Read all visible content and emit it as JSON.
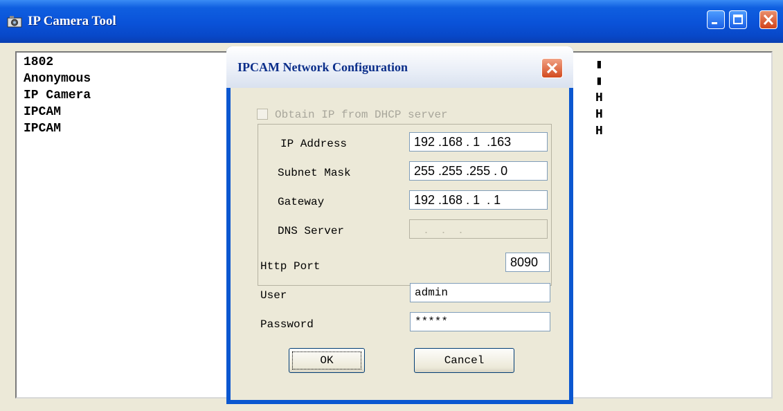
{
  "window": {
    "title": "IP Camera Tool",
    "colors": {
      "titlebar": "#0a52d8",
      "close": "#d2431b"
    }
  },
  "camera_list": {
    "names": [
      "1802",
      "Anonymous",
      "IP Camera",
      "IPCAM",
      "IPCAM"
    ],
    "right_column": [
      "▮",
      "▮",
      "H",
      "H",
      "H"
    ]
  },
  "dialog": {
    "title": "IPCAM Network Configuration",
    "dhcp": {
      "label": "Obtain IP from DHCP server",
      "checked": false,
      "enabled": false
    },
    "fields": {
      "ip_address": {
        "label": "IP Address",
        "value": "192 .168 . 1  .163"
      },
      "subnet_mask": {
        "label": "Subnet Mask",
        "value": "255 .255 .255 . 0"
      },
      "gateway": {
        "label": "Gateway",
        "value": "192 .168 . 1  . 1"
      },
      "dns_server": {
        "label": "DNS Server",
        "value": "   .    .    ."
      },
      "http_port": {
        "label": "Http Port",
        "value": "8090"
      },
      "user": {
        "label": "User",
        "value": "admin"
      },
      "password": {
        "label": "Password",
        "value": "*****"
      }
    },
    "buttons": {
      "ok": "OK",
      "cancel": "Cancel"
    }
  }
}
